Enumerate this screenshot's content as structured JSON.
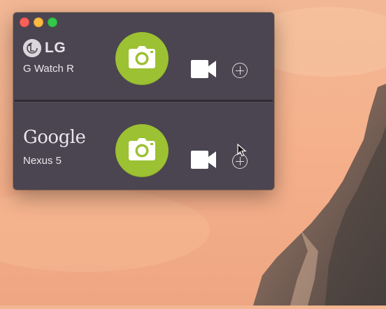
{
  "window": {
    "traffic_lights": [
      "close",
      "minimize",
      "zoom"
    ]
  },
  "devices": [
    {
      "brand_logo": "LG",
      "brand_icon": "lg-logo-icon",
      "model": "G Watch R",
      "actions": [
        "camera-icon",
        "video-camera-icon",
        "plus-circle-icon"
      ]
    },
    {
      "brand_logo": "Google",
      "brand_icon": "google-logo",
      "model": "Nexus 5",
      "actions": [
        "camera-icon",
        "video-camera-icon",
        "plus-circle-icon"
      ]
    }
  ],
  "colors": {
    "window_bg": "#4a4550",
    "capture_green": "#9cc132",
    "text": "#e9e7ec",
    "close": "#fc605b",
    "minimize": "#fdbc40",
    "zoom": "#34c84a"
  }
}
